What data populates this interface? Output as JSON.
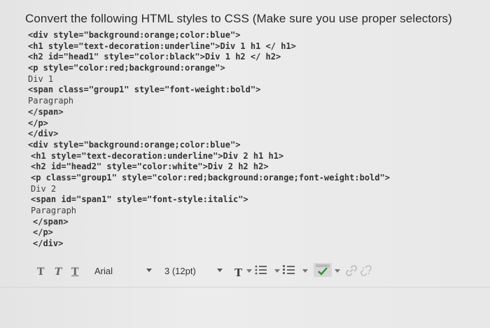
{
  "question": "Convert the following HTML styles to CSS (Make sure you use proper selectors)",
  "code_lines": [
    "<div style=\"background:orange;color:blue\">",
    "<h1 style=\"text-decoration:underline\">Div 1 h1 </ h1>",
    "<h2 id=\"head1\" style=\"color:black\">Div 1 h2 </ h2>",
    "<p style=\"color:red;background:orange\">",
    "Div 1",
    "<span class=\"group1\" style=\"font-weight:bold\">",
    "Paragraph",
    "</span>",
    "</p>",
    "</div>",
    "<div style=\"background:orange;color:blue\">",
    "<h1 style=\"text-decoration:underline\">Div 2 h1 h1>",
    "<h2 id=\"head2\" style=\"color:white\">Div 2 h2 h2>",
    "<p class=\"group1\" style=\"color:red;background:orange;font-weight:bold\">",
    "Div 2",
    "<span id=\"span1\" style=\"font-style:italic\">",
    "Paragraph",
    "</span>",
    "</p>",
    "</div>"
  ],
  "toolbar": {
    "format_buttons": [
      "T",
      "T",
      "T"
    ],
    "font_family": "Arial",
    "font_size": "3 (12pt)",
    "text_color_label": "T"
  }
}
